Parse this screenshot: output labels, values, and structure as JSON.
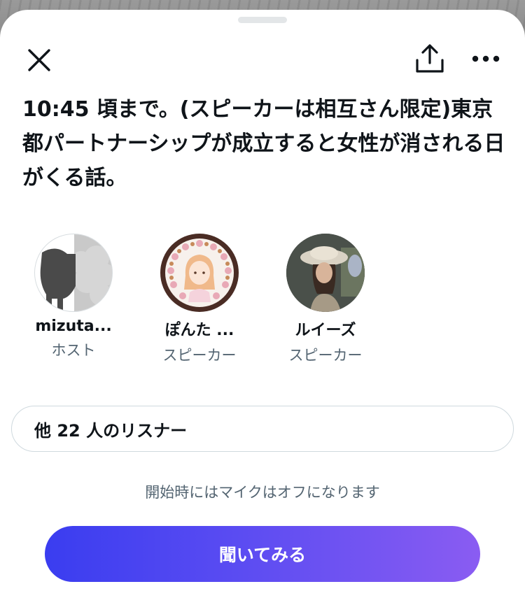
{
  "title": "10:45 頃まで。(スピーカーは相互さん限定)東京都パートナーシップが成立すると女性が消される日がくる話。",
  "header": {
    "close_icon": "close-icon",
    "share_icon": "share-icon",
    "more_icon": "more-horizontal-icon"
  },
  "participants": [
    {
      "name": "mizuta...",
      "role": "ホスト",
      "avatar": "sheep-avatar"
    },
    {
      "name": "ぽんた ...",
      "role": "スピーカー",
      "avatar": "donut-ring-girl-avatar"
    },
    {
      "name": "ルイーズ",
      "role": "スピーカー",
      "avatar": "woman-in-hat-avatar"
    }
  ],
  "listeners_label": "他 22 人のリスナー",
  "mic_note": "開始時にはマイクはオフになります",
  "listen_button": "聞いてみる",
  "colors": {
    "text_primary": "#0f1419",
    "text_secondary": "#536471",
    "button_gradient_start": "#3a3df0",
    "button_gradient_end": "#8a5cf2"
  }
}
